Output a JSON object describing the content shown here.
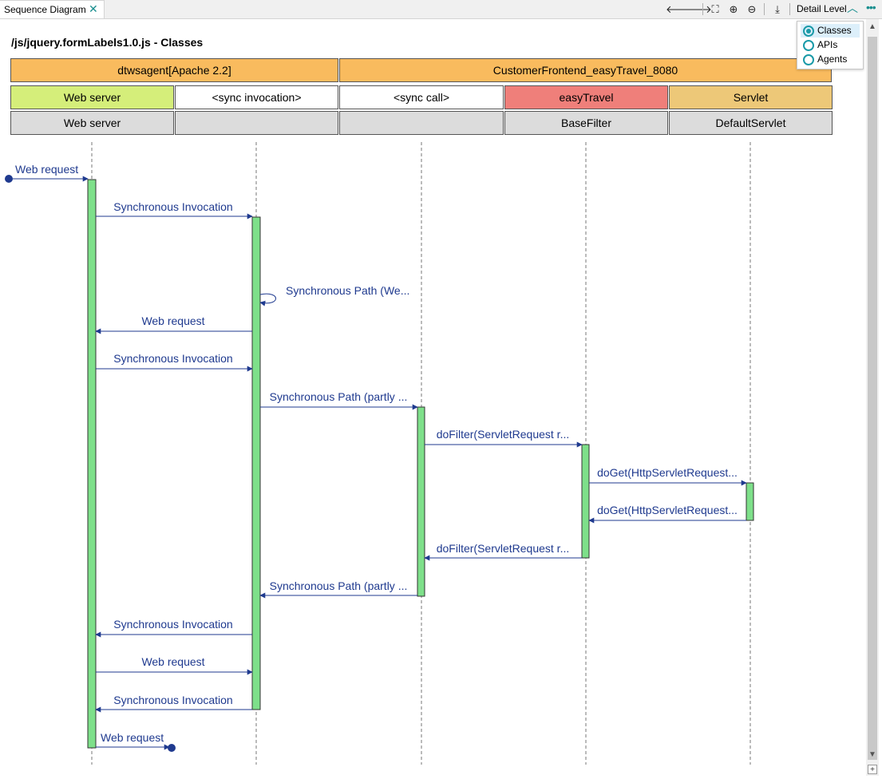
{
  "tab": {
    "label": "Sequence Diagram",
    "close_icon": "close-icon"
  },
  "toolbar": {
    "buttons": [
      "back-arrow-icon",
      "forward-arrow-icon",
      "fit-to-screen-icon",
      "zoom-in-icon",
      "zoom-out-icon",
      "download-icon"
    ],
    "detail_level_label": "Detail Level",
    "more_icon": "more-icon"
  },
  "detail_menu": {
    "options": [
      {
        "label": "Classes",
        "selected": true
      },
      {
        "label": "APIs",
        "selected": false
      },
      {
        "label": "Agents",
        "selected": false
      }
    ]
  },
  "diagram": {
    "title": "/js/jquery.formLabels1.0.js - Classes",
    "agents": [
      {
        "label": "dtwsagent[Apache 2.2]",
        "color": "#f9bb5e"
      },
      {
        "label": "CustomerFrontend_easyTravel_8080",
        "color": "#f9bb5e"
      }
    ],
    "apis": [
      {
        "label": "Web server",
        "color": "#d5ee7a"
      },
      {
        "label": "<sync invocation>",
        "color": "#ffffff"
      },
      {
        "label": "<sync call>",
        "color": "#ffffff"
      },
      {
        "label": "easyTravel",
        "color": "#ef7f7a"
      },
      {
        "label": "Servlet",
        "color": "#edc878"
      }
    ],
    "classes": [
      {
        "label": "Web server"
      },
      {
        "label": ""
      },
      {
        "label": ""
      },
      {
        "label": "BaseFilter"
      },
      {
        "label": "DefaultServlet"
      }
    ],
    "messages": [
      {
        "label": "Web request"
      },
      {
        "label": "Synchronous Invocation"
      },
      {
        "label": "Synchronous Path (We..."
      },
      {
        "label": "Web request"
      },
      {
        "label": "Synchronous Invocation"
      },
      {
        "label": "Synchronous Path (partly ..."
      },
      {
        "label": "doFilter(ServletRequest r..."
      },
      {
        "label": "doGet(HttpServletRequest..."
      },
      {
        "label": "doGet(HttpServletRequest..."
      },
      {
        "label": "doFilter(ServletRequest r..."
      },
      {
        "label": "Synchronous Path (partly ..."
      },
      {
        "label": "Synchronous Invocation"
      },
      {
        "label": "Web request"
      },
      {
        "label": "Synchronous Invocation"
      },
      {
        "label": "Web request"
      }
    ],
    "colors": {
      "activation": "#7ee08a",
      "message": "#1f3a8f"
    }
  }
}
